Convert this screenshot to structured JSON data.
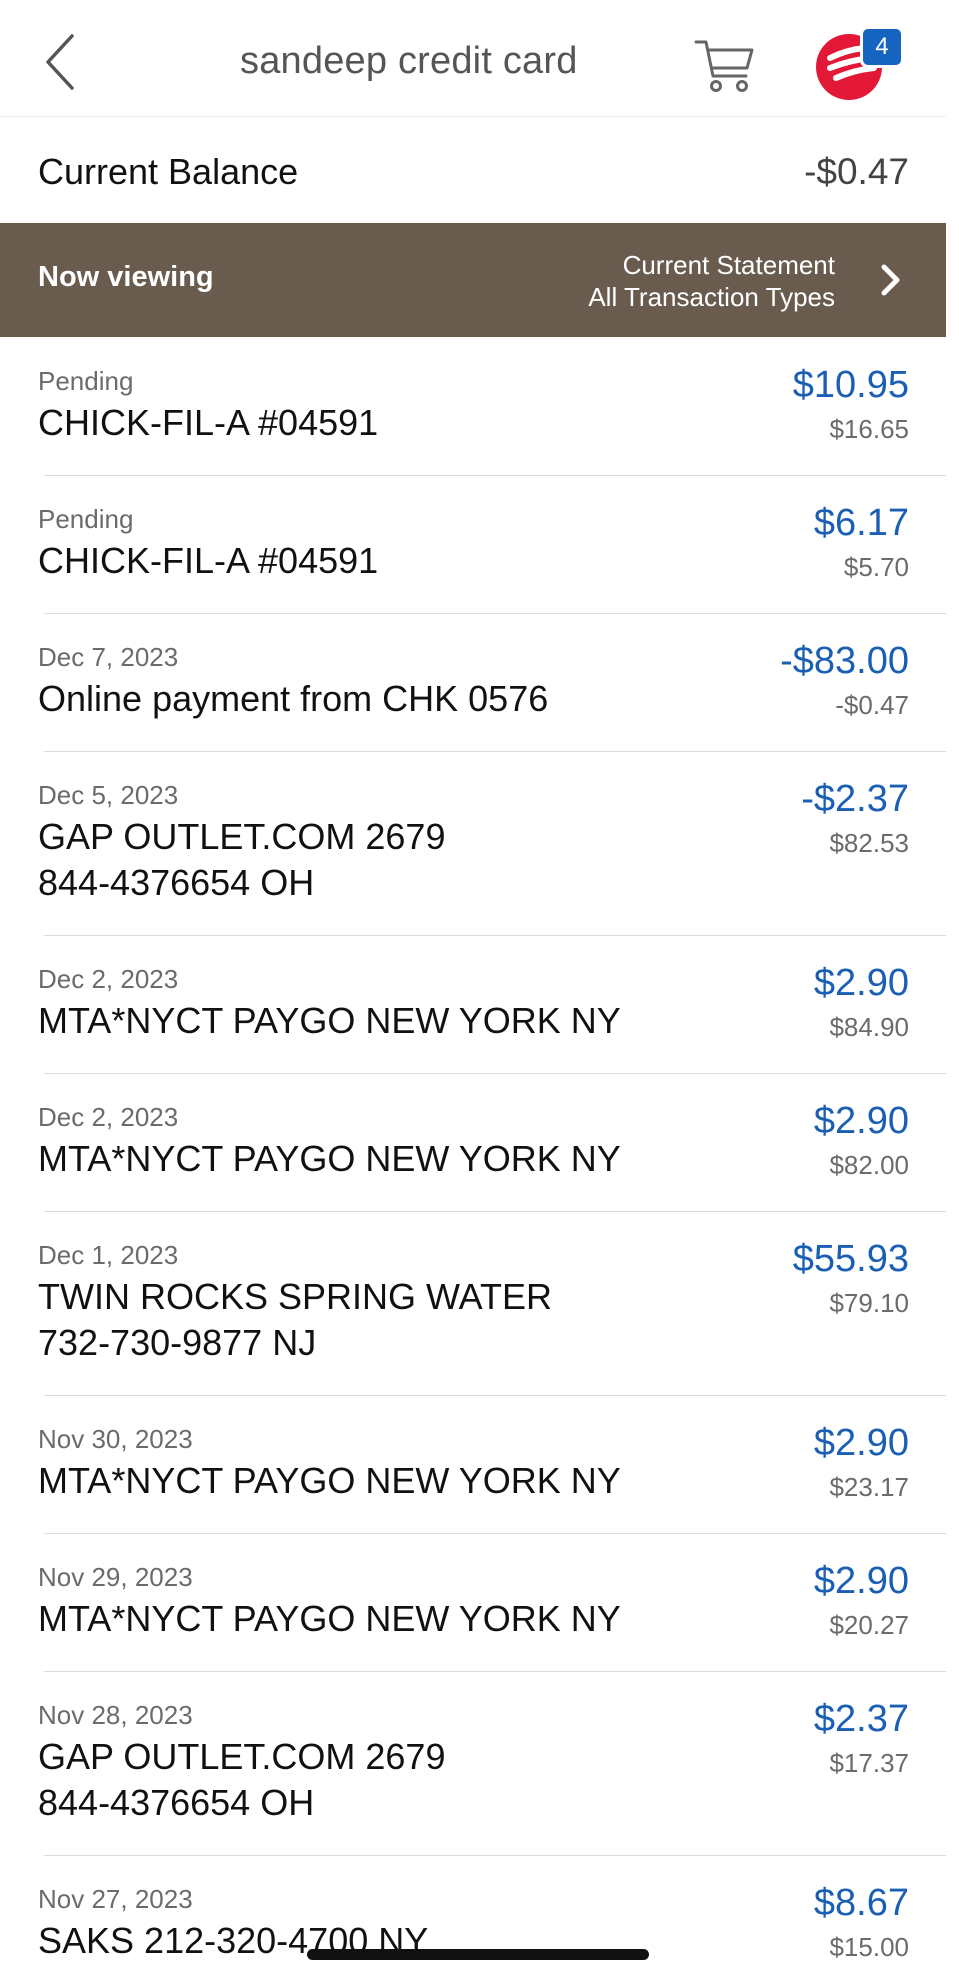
{
  "header": {
    "title": "sandeep credit card",
    "back_icon": "chevron-left-icon",
    "cart_icon": "cart-icon",
    "notification_count": "4",
    "brand_color": "#e31837",
    "badge_color": "#1565c0"
  },
  "balance": {
    "label": "Current Balance",
    "value": "-$0.47"
  },
  "filter": {
    "label": "Now viewing",
    "statement": "Current Statement",
    "types": "All Transaction Types",
    "background_color": "#6a5b4f"
  },
  "transactions": [
    {
      "date": "Pending",
      "description": "CHICK-FIL-A #04591",
      "amount": "$10.95",
      "balance": "$16.65"
    },
    {
      "date": "Pending",
      "description": "CHICK-FIL-A #04591",
      "amount": "$6.17",
      "balance": "$5.70"
    },
    {
      "date": "Dec 7, 2023",
      "description": "Online payment from CHK 0576",
      "amount": "-$83.00",
      "balance": "-$0.47"
    },
    {
      "date": "Dec 5, 2023",
      "description": "GAP OUTLET.COM 2679 844-4376654 OH",
      "amount": "-$2.37",
      "balance": "$82.53"
    },
    {
      "date": "Dec 2, 2023",
      "description": "MTA*NYCT PAYGO NEW YORK NY",
      "amount": "$2.90",
      "balance": "$84.90"
    },
    {
      "date": "Dec 2, 2023",
      "description": "MTA*NYCT PAYGO NEW YORK NY",
      "amount": "$2.90",
      "balance": "$82.00"
    },
    {
      "date": "Dec 1, 2023",
      "description": "TWIN ROCKS SPRING WATER 732-730-9877 NJ",
      "amount": "$55.93",
      "balance": "$79.10"
    },
    {
      "date": "Nov 30, 2023",
      "description": "MTA*NYCT PAYGO NEW YORK NY",
      "amount": "$2.90",
      "balance": "$23.17"
    },
    {
      "date": "Nov 29, 2023",
      "description": "MTA*NYCT PAYGO NEW YORK NY",
      "amount": "$2.90",
      "balance": "$20.27"
    },
    {
      "date": "Nov 28, 2023",
      "description": "GAP OUTLET.COM 2679 844-4376654 OH",
      "amount": "$2.37",
      "balance": "$17.37"
    },
    {
      "date": "Nov 27, 2023",
      "description": "SAKS 212-320-4700 NY",
      "amount": "$8.67",
      "balance": "$15.00"
    }
  ],
  "colors": {
    "amount_blue": "#1a5fb4",
    "secondary_gray": "#6b6b6b"
  }
}
